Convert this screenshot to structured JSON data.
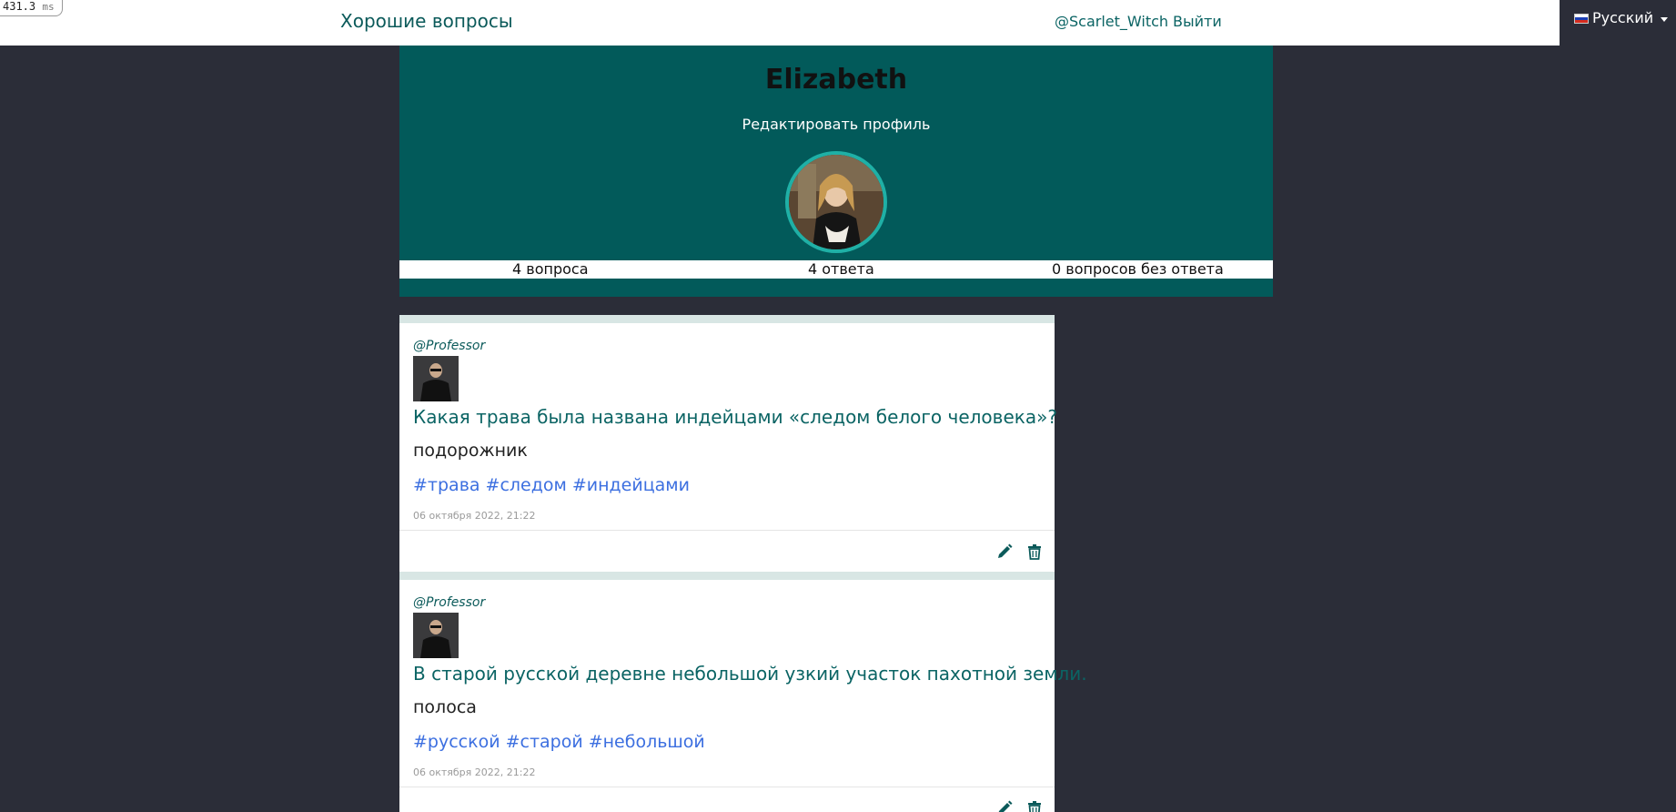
{
  "timer": {
    "value": "431.3",
    "unit": "ms"
  },
  "navbar": {
    "brand": "Хорошие вопросы",
    "username": "@Scarlet_Witch",
    "logout": "Выйти"
  },
  "language": {
    "label": "Русский"
  },
  "profile": {
    "name": "Elizabeth",
    "edit_link": "Редактировать профиль",
    "stats": {
      "questions": "4 вопроса",
      "answers": "4 ответа",
      "unanswered": "0 вопросов без ответа"
    }
  },
  "cards": [
    {
      "author": "@Professor",
      "title": "Какая трава была названа индейцами «следом белого человека»?",
      "answer": "подорожник",
      "tags": [
        "#трава",
        "#следом",
        "#индейцами"
      ],
      "date": "06 октября 2022, 21:22"
    },
    {
      "author": "@Professor",
      "title": "В старой русской деревне небольшой узкий участок пахотной земли.",
      "answer": "полоса",
      "tags": [
        "#русской",
        "#старой",
        "#небольшой"
      ],
      "date": "06 октября 2022, 21:22"
    }
  ],
  "colors": {
    "accent": "#0b6464",
    "banner": "#025a5a",
    "tag": "#3c6fe0",
    "background": "#2b2d38"
  },
  "icons": [
    "pencil-icon",
    "trash-icon",
    "russian-flag-icon",
    "caret-down-icon"
  ]
}
